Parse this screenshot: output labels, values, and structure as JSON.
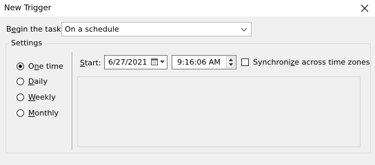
{
  "window": {
    "title": "New Trigger",
    "close_icon": "close-icon"
  },
  "begin_task": {
    "label": "Begin the task:",
    "value": "On a schedule"
  },
  "settings": {
    "legend": "Settings",
    "schedule_options": [
      {
        "label": "One time",
        "selected": true
      },
      {
        "label": "Daily",
        "selected": false
      },
      {
        "label": "Weekly",
        "selected": false
      },
      {
        "label": "Monthly",
        "selected": false
      }
    ],
    "start": {
      "label": "Start:",
      "date": "6/27/2021",
      "time": "9:16:06 AM",
      "sync_label": "Synchronize across time zones",
      "sync_checked": false
    }
  }
}
